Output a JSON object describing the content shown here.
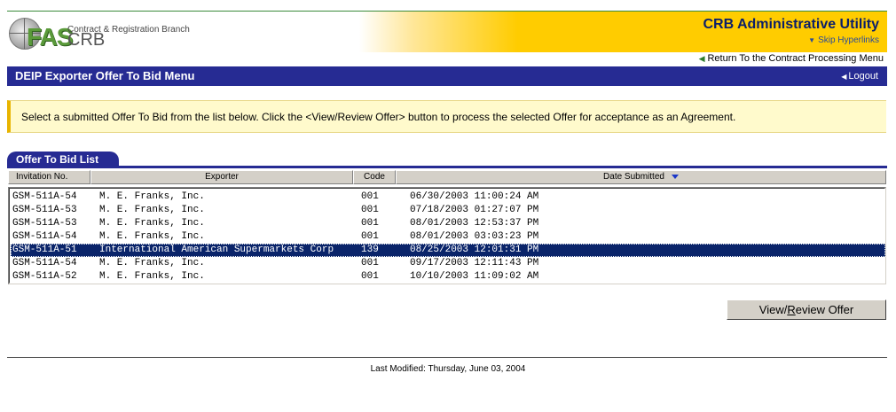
{
  "header": {
    "branch_name": "Contract & Registration Branch",
    "logo_fas": "FAS",
    "logo_crb": "CRB",
    "app_title": "CRB Administrative Utility",
    "skip_link": "Skip Hyperlinks",
    "return_link": "Return To the Contract Processing Menu"
  },
  "title_bar": {
    "page_title": "DEIP Exporter Offer To Bid Menu",
    "logout": "Logout"
  },
  "message": "Select a submitted Offer To Bid from the list below.  Click the <View/Review Offer> button to process the selected Offer for acceptance as an Agreement.",
  "list": {
    "tab_label": "Offer To Bid List",
    "columns": {
      "invitation": "Invitation No.",
      "exporter": "Exporter",
      "code": "Code",
      "date": "Date Submitted"
    },
    "rows": [
      {
        "invitation": "GSM-511A-54",
        "exporter": "M. E. Franks, Inc.",
        "code": "001",
        "date": "06/30/2003 11:00:24 AM"
      },
      {
        "invitation": "GSM-511A-53",
        "exporter": "M. E. Franks, Inc.",
        "code": "001",
        "date": "07/18/2003 01:27:07 PM"
      },
      {
        "invitation": "GSM-511A-53",
        "exporter": "M. E. Franks, Inc.",
        "code": "001",
        "date": "08/01/2003 12:53:37 PM"
      },
      {
        "invitation": "GSM-511A-54",
        "exporter": "M. E. Franks, Inc.",
        "code": "001",
        "date": "08/01/2003 03:03:23 PM"
      },
      {
        "invitation": "GSM-511A-51",
        "exporter": "International American Supermarkets Corp",
        "code": "139",
        "date": "08/25/2003 12:01:31 PM"
      },
      {
        "invitation": "GSM-511A-54",
        "exporter": "M. E. Franks, Inc.",
        "code": "001",
        "date": "09/17/2003 12:11:43 PM"
      },
      {
        "invitation": "GSM-511A-52",
        "exporter": "M. E. Franks, Inc.",
        "code": "001",
        "date": "10/10/2003 11:09:02 AM"
      }
    ],
    "selected_row": 4
  },
  "buttons": {
    "view_review_label_pre": "View/",
    "view_review_label_u": "R",
    "view_review_label_post": "eview Offer"
  },
  "footer": {
    "last_modified": "Last Modified:  Thursday, June 03, 2004"
  },
  "colors": {
    "title_bar": "#262b93",
    "gold": "#ffcc00",
    "selection": "#0a246a",
    "message_bg": "#fffacc"
  }
}
